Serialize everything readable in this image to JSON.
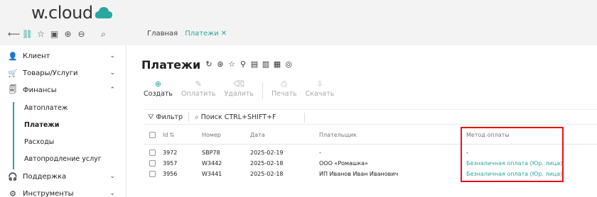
{
  "logo": {
    "text": "w.cloud"
  },
  "topbar": {
    "icons": [
      "back-arrow-icon",
      "hierarchy-icon",
      "star-icon",
      "briefcase-icon",
      "plus-circle-icon",
      "minus-circle-icon",
      "search-icon"
    ],
    "tabs": [
      {
        "label": "Главная",
        "active": false
      },
      {
        "label": "Платежи",
        "active": true,
        "close": "✕"
      }
    ]
  },
  "sidebar": {
    "items": [
      {
        "label": "Клиент",
        "icon": "user-icon",
        "chevron": "⌄"
      },
      {
        "label": "Товары/Услуги",
        "icon": "basket-icon",
        "chevron": "⌄"
      },
      {
        "label": "Финансы",
        "icon": "document-icon",
        "chevron": "⌃"
      },
      {
        "label": "Поддержка",
        "icon": "headset-icon",
        "chevron": "⌄"
      },
      {
        "label": "Инструменты",
        "icon": "gear-icon",
        "chevron": "⌄"
      }
    ],
    "finance_sub": [
      {
        "label": "Автоплатеж",
        "active": false
      },
      {
        "label": "Платежи",
        "active": true
      },
      {
        "label": "Расходы",
        "active": false
      },
      {
        "label": "Автопродление услуг",
        "active": false
      }
    ]
  },
  "main": {
    "title": "Платежи",
    "actions": [
      {
        "label": "Создать",
        "enabled": true,
        "icon": "plus-circle-icon"
      },
      {
        "label": "Оплатить",
        "enabled": false,
        "icon": "edit-icon"
      },
      {
        "label": "Удалить",
        "enabled": false,
        "icon": "delete-icon"
      },
      {
        "label": "Печать",
        "enabled": false,
        "icon": "print-icon"
      },
      {
        "label": "Скачать",
        "enabled": false,
        "icon": "download-icon"
      }
    ],
    "filter": {
      "label": "Фильтр",
      "search": "Поиск CTRL+SHIFT+F"
    },
    "table": {
      "columns": [
        "Id",
        "Номер",
        "Дата",
        "Плательщик",
        "Метод оплаты"
      ],
      "rows": [
        {
          "id": "3972",
          "number": "SBP78",
          "date": "2025-02-19",
          "payer": "-",
          "method": "-"
        },
        {
          "id": "3957",
          "number": "W3442",
          "date": "2025-02-18",
          "payer": "ООО «Ромашка»",
          "method": "Безналичная оплата (Юр. лица)"
        },
        {
          "id": "3956",
          "number": "W3441",
          "date": "2025-02-18",
          "payer": "ИП Иванов Иван Иванович",
          "method": "Безналичная оплата (Юр. лица)"
        }
      ]
    }
  },
  "colors": {
    "accent": "#2aa7a0",
    "highlight": "#ee1111"
  }
}
